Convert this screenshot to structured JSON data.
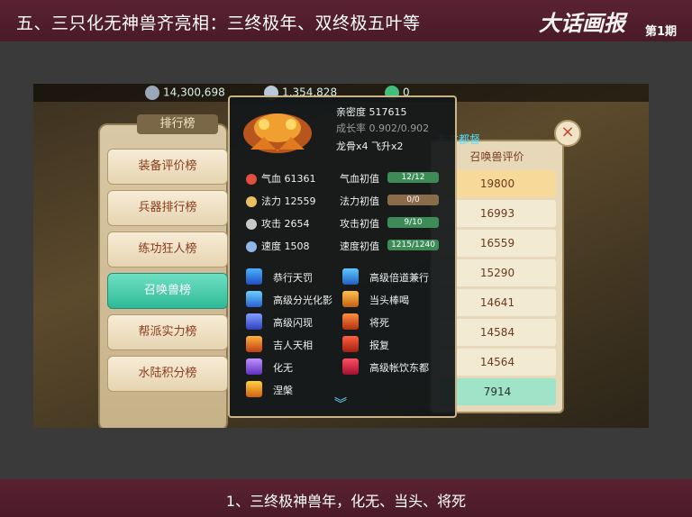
{
  "header": {
    "title": "五、三只化无神兽齐亮相：三终极年、双终极五叶等",
    "brand": "大话画报",
    "issue": "第1期"
  },
  "footer": {
    "caption": "1、三终极神兽年，化无、当头、将死"
  },
  "game": {
    "resources": {
      "silver": "14,300,698",
      "crystal": "1,354,828",
      "jade": "0"
    },
    "panel_title": "排行榜",
    "tabs": [
      {
        "label": "装备评价榜",
        "active": false
      },
      {
        "label": "兵器排行榜",
        "active": false
      },
      {
        "label": "练功狂人榜",
        "active": false
      },
      {
        "label": "召唤兽榜",
        "active": true
      },
      {
        "label": "帮派实力榜",
        "active": false
      },
      {
        "label": "水陆积分榜",
        "active": false
      }
    ],
    "map_name": "东方都督",
    "ranking": {
      "column_header": "召唤兽评价",
      "rows": [
        "19800",
        "16993",
        "16559",
        "15290",
        "14641",
        "14584",
        "14564",
        "7914"
      ]
    },
    "close_symbol": "×",
    "pet_popup": {
      "intimacy": "亲密度 517615",
      "growth": "成长率 0.902/0.902",
      "bones": "龙骨x4  飞升x2",
      "stats": [
        {
          "label": "气血 61361",
          "init_label": "气血初值",
          "bar": "12/12",
          "color": "#e0503c"
        },
        {
          "label": "法力 12559",
          "init_label": "法力初值",
          "bar": "0/0",
          "color": "#e8c060"
        },
        {
          "label": "攻击 2654",
          "init_label": "攻击初值",
          "bar": "9/10",
          "color": "#c8c8c8"
        },
        {
          "label": "速度 1508",
          "init_label": "速度初值",
          "bar": "1215/1240",
          "color": "#8fb8e8"
        }
      ],
      "skills_left": [
        "恭行天罚",
        "高级分光化影",
        "高级闪现",
        "吉人天相",
        "化无",
        "涅槃"
      ],
      "skills_right": [
        "高级倍道兼行",
        "当头棒喝",
        "将死",
        "报复",
        "高级帐饮东都"
      ],
      "more_symbol": "︾"
    }
  }
}
